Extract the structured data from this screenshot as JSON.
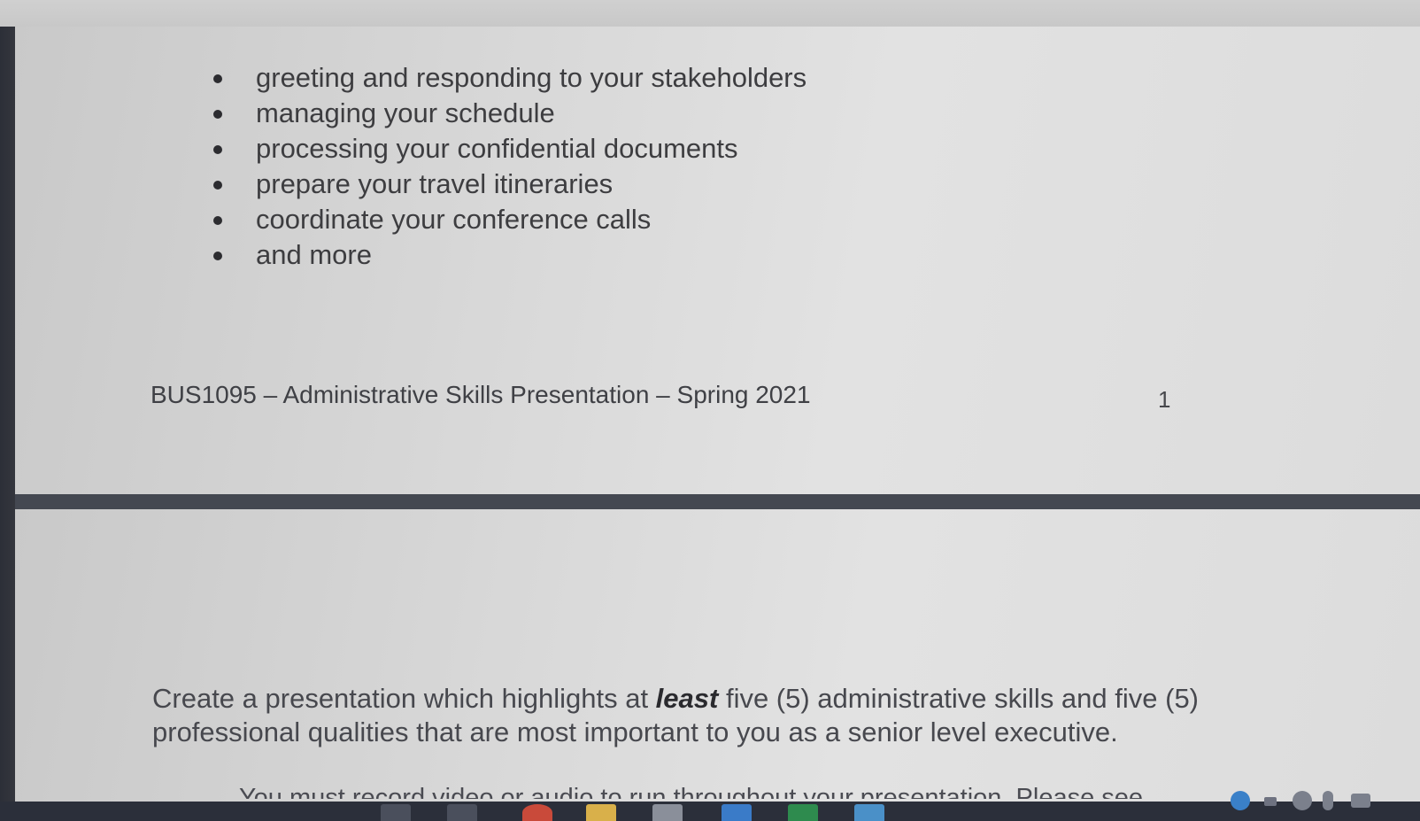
{
  "document": {
    "bullets": [
      "greeting and responding to your stakeholders",
      "managing your schedule",
      "processing your confidential documents",
      "prepare your travel itineraries",
      "coordinate your conference calls",
      "and more"
    ],
    "footer": "BUS1095 – Administrative Skills Presentation – Spring 2021",
    "page_number": "1",
    "body_text_before": "Create a presentation which highlights at ",
    "body_text_emphasis": "least",
    "body_text_after": " five (5) administrative skills and five (5) professional qualities that are most important to you as a senior level executive.",
    "cutoff_line": "You must record video or audio to run throughout your presentation. Please see"
  },
  "taskbar": {
    "icons": [
      "search-icon",
      "task-view-icon",
      "chrome-icon",
      "file-explorer-icon",
      "store-icon",
      "mail-icon",
      "excel-icon",
      "app-icon"
    ],
    "tray": [
      "help-icon",
      "chevron-up-icon",
      "onedrive-icon",
      "microphone-icon",
      "keyboard-icon"
    ]
  },
  "colors": {
    "page": "#dcdcdc",
    "page_break": "#444851",
    "taskbar": "#2b2f3a",
    "text": "#3d3d40"
  }
}
